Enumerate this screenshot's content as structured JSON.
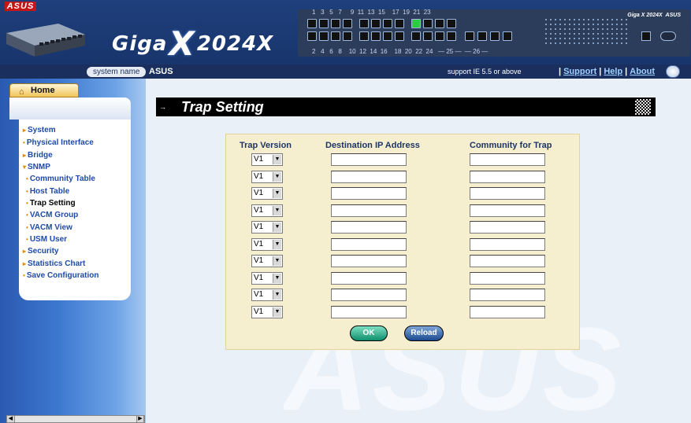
{
  "header": {
    "brand": "ASUS",
    "product_name": "Giga",
    "product_x": "X",
    "product_model": "2024X",
    "port_numbers_top": "1   3   5   7     9  11  13  15    17  19  21  23",
    "port_numbers_bottom": "2   4   6   8    10  12  14  16    18  20  22  24   — 25 —  — 26 —"
  },
  "subbar": {
    "system_name_label": "system name",
    "system_name_value": "ASUS",
    "support_text": "support IE 5.5 or above",
    "links": [
      "Support",
      "Help",
      "About"
    ]
  },
  "sidebar": {
    "home_label": "Home",
    "items": [
      {
        "label": "System",
        "marker": "▸"
      },
      {
        "label": "Physical Interface",
        "marker": "•"
      },
      {
        "label": "Bridge",
        "marker": "▸"
      },
      {
        "label": "SNMP",
        "marker": "▾"
      },
      {
        "label": "Community Table",
        "marker": "•"
      },
      {
        "label": "Host Table",
        "marker": "•"
      },
      {
        "label": "Trap Setting",
        "marker": "•"
      },
      {
        "label": "VACM Group",
        "marker": "•"
      },
      {
        "label": "VACM View",
        "marker": "•"
      },
      {
        "label": "USM User",
        "marker": "•"
      },
      {
        "label": "Security",
        "marker": "▸"
      },
      {
        "label": "Statistics Chart",
        "marker": "▸"
      },
      {
        "label": "Save Configuration",
        "marker": "•"
      }
    ]
  },
  "main": {
    "title": "Trap Setting",
    "columns": [
      "Trap Version",
      "Destination IP Address",
      "Community for Trap"
    ],
    "rows": [
      {
        "version": "V1",
        "ip": "",
        "community": ""
      },
      {
        "version": "V1",
        "ip": "",
        "community": ""
      },
      {
        "version": "V1",
        "ip": "",
        "community": ""
      },
      {
        "version": "V1",
        "ip": "",
        "community": ""
      },
      {
        "version": "V1",
        "ip": "",
        "community": ""
      },
      {
        "version": "V1",
        "ip": "",
        "community": ""
      },
      {
        "version": "V1",
        "ip": "",
        "community": ""
      },
      {
        "version": "V1",
        "ip": "",
        "community": ""
      },
      {
        "version": "V1",
        "ip": "",
        "community": ""
      },
      {
        "version": "V1",
        "ip": "",
        "community": ""
      }
    ],
    "buttons": {
      "ok": "OK",
      "reload": "Reload"
    },
    "watermark": "ASUS"
  }
}
